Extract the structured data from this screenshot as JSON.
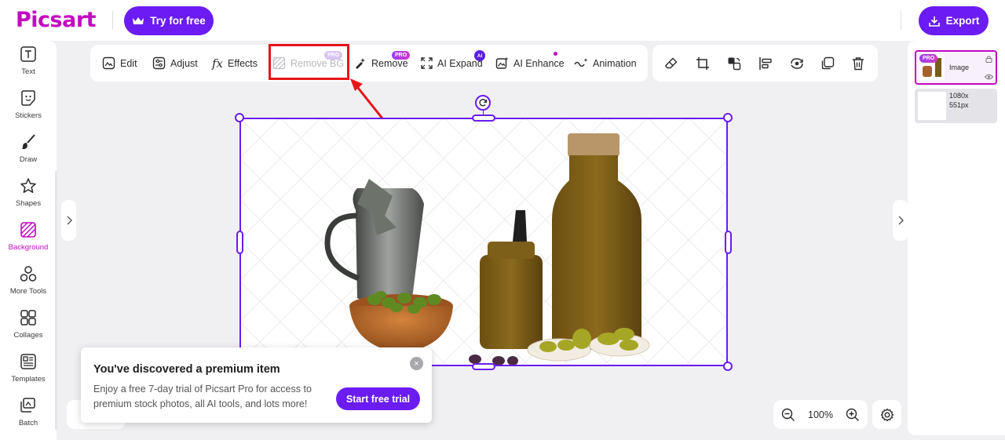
{
  "header": {
    "logo": "Picsart",
    "try_label": "Try for free",
    "export_label": "Export"
  },
  "sidebar": {
    "items": [
      {
        "label": "Text",
        "icon": "text-icon"
      },
      {
        "label": "Stickers",
        "icon": "sticker-icon"
      },
      {
        "label": "Draw",
        "icon": "brush-icon"
      },
      {
        "label": "Shapes",
        "icon": "star-icon"
      },
      {
        "label": "Background",
        "icon": "background-icon",
        "active": true
      },
      {
        "label": "More Tools",
        "icon": "more-tools-icon"
      },
      {
        "label": "Collages",
        "icon": "collage-icon"
      },
      {
        "label": "Templates",
        "icon": "templates-icon"
      },
      {
        "label": "Batch",
        "icon": "batch-icon"
      }
    ]
  },
  "toolbar": {
    "edit": "Edit",
    "adjust": "Adjust",
    "effects": "Effects",
    "remove_bg": "Remove BG",
    "remove": "Remove",
    "ai_expand": "AI Expand",
    "ai_enhance": "AI Enhance",
    "animation": "Animation",
    "pro_badge": "PRO",
    "ai_badge": "AI"
  },
  "layers": {
    "pro_badge": "PRO",
    "layer1_name": "Image",
    "layer2_size": "1080x\n551px"
  },
  "zoom": {
    "value": "100%"
  },
  "popup": {
    "title": "You've discovered a premium item",
    "body": "Enjoy a free 7-day trial of Picsart Pro for access to premium stock photos, all AI tools, and lots more!",
    "cta": "Start free trial",
    "close": "×"
  },
  "colors": {
    "brand": "#c209c1",
    "primary": "#6b1cf2",
    "highlight": "#e8141a"
  }
}
